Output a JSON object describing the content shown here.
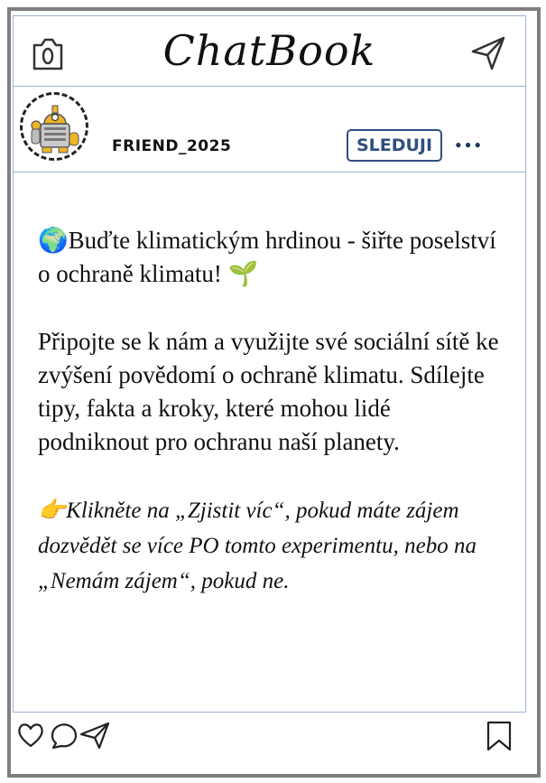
{
  "app": {
    "title": "ChatBook"
  },
  "post": {
    "username": "FRIEND_2025",
    "follow_label": "SLEDUJI",
    "more_label": "•••",
    "headline_emoji": "🌍",
    "headline": "Buďte klimatickým hrdinou - šiřte poselství o ochraně klimatu!",
    "headline_end_emoji": "🌱",
    "body": "Připojte se k nám a využijte své sociální sítě ke zvýšení povědomí o ochraně klimatu. Sdílejte tipy, fakta a kroky, které mohou lidé podniknout pro ochranu naší planety.",
    "cta_emoji": "👉",
    "cta": "Klikněte na „Zjistit víc“, pokud máte zájem dozvědět se více PO tomto experimentu, nebo na „Nemám zájem“, pokud ne."
  },
  "icons": {
    "camera": "camera-icon",
    "send": "send-icon",
    "like": "heart-icon",
    "comment": "comment-icon",
    "share": "share-icon",
    "bookmark": "bookmark-icon"
  },
  "colors": {
    "frame": "#7f7f7f",
    "divider": "#9fb3d1",
    "accent": "#2f4f7f"
  }
}
